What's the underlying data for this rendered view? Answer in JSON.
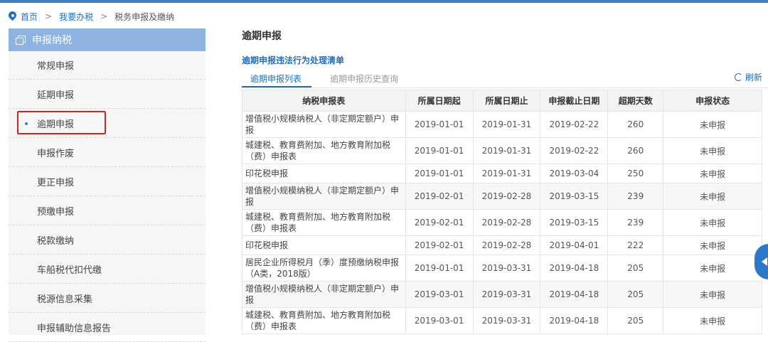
{
  "breadcrumb": {
    "home": "首页",
    "sep": ">",
    "level1": "我要办税",
    "level2": "税务申报及缴纳"
  },
  "sidebar": {
    "header": "申报纳税",
    "items": [
      {
        "label": "常规申报"
      },
      {
        "label": "延期申报"
      },
      {
        "label": "逾期申报",
        "active": true
      },
      {
        "label": "申报作废"
      },
      {
        "label": "更正申报"
      },
      {
        "label": "预缴申报"
      },
      {
        "label": "税款缴纳"
      },
      {
        "label": "车船税代扣代缴"
      },
      {
        "label": "税源信息采集"
      },
      {
        "label": "申报辅助信息报告"
      }
    ]
  },
  "main": {
    "title": "逾期申报",
    "subtitle": "逾期申报违法行为处理清单",
    "tabs": [
      "逾期申报列表",
      "逾期申报历史查询"
    ],
    "refresh": "刷新"
  },
  "table": {
    "headers": [
      "纳税申报表",
      "所属日期起",
      "所属日期止",
      "申报截止日期",
      "超期天数",
      "申报状态"
    ],
    "rows": [
      [
        "增值税小规模纳税人（非定期定额户）申报",
        "2019-01-01",
        "2019-01-31",
        "2019-02-22",
        "260",
        "未申报"
      ],
      [
        "城建税、教育费附加、地方教育附加税（费）申报表",
        "2019-01-01",
        "2019-01-31",
        "2019-02-22",
        "260",
        "未申报"
      ],
      [
        "印花税申报",
        "2019-01-01",
        "2019-01-31",
        "2019-03-04",
        "250",
        "未申报"
      ],
      [
        "增值税小规模纳税人（非定期定额户）申报",
        "2019-02-01",
        "2019-02-28",
        "2019-03-15",
        "239",
        "未申报"
      ],
      [
        "城建税、教育费附加、地方教育附加税（费）申报表",
        "2019-02-01",
        "2019-02-28",
        "2019-03-15",
        "239",
        "未申报"
      ],
      [
        "印花税申报",
        "2019-02-01",
        "2019-02-28",
        "2019-04-01",
        "222",
        "未申报"
      ],
      [
        "居民企业所得税月（季）度预缴纳税申报（A类，2018版）",
        "2019-01-01",
        "2019-03-31",
        "2019-04-18",
        "205",
        "未申报"
      ],
      [
        "增值税小规模纳税人（非定期定额户）申报",
        "2019-03-01",
        "2019-03-31",
        "2019-04-18",
        "205",
        "未申报"
      ],
      [
        "城建税、教育费附加、地方教育附加税（费）申报表",
        "2019-03-01",
        "2019-03-31",
        "2019-04-18",
        "205",
        "未申报"
      ]
    ]
  },
  "colors": {
    "accent": "#1e6fc0",
    "sidebar_header": "#8db3e0",
    "highlight": "#d9231d"
  }
}
